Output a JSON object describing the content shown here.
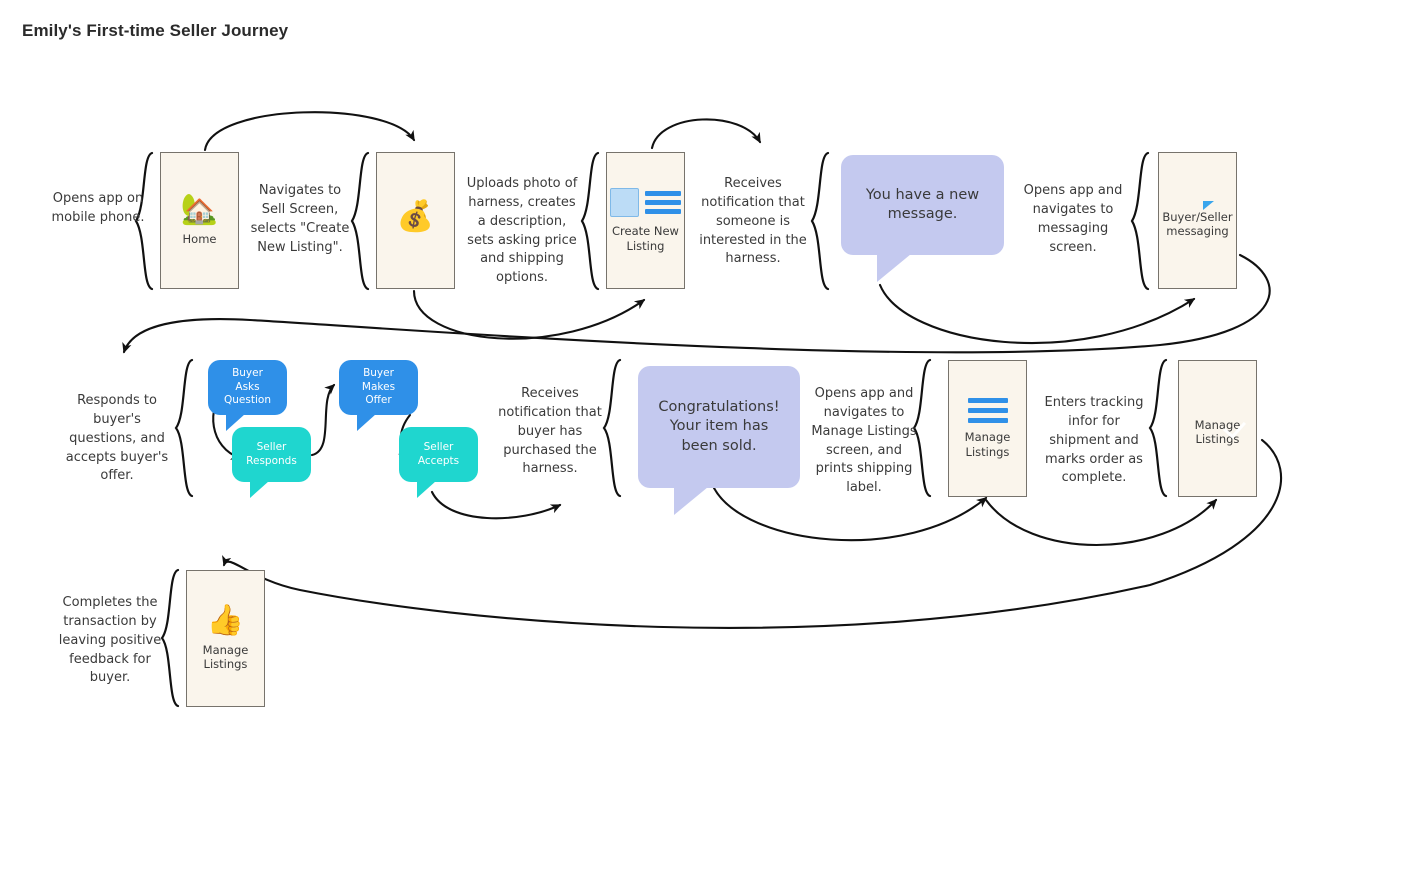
{
  "title": "Emily's First-time Seller Journey",
  "notes": [
    {
      "id": "n1",
      "text": "Opens app on mobile phone."
    },
    {
      "id": "n2",
      "text": "Navigates to Sell Screen, selects \"Create New Listing\"."
    },
    {
      "id": "n3",
      "text": "Uploads photo of harness, creates a description, sets asking price and shipping options."
    },
    {
      "id": "n4",
      "text": "Receives notification that someone is interested in the harness."
    },
    {
      "id": "n5",
      "text": "Opens app and navigates to messaging screen."
    },
    {
      "id": "n6",
      "text": "Responds to buyer's questions, and accepts buyer's offer."
    },
    {
      "id": "n7",
      "text": "Receives notification that buyer has purchased the harness."
    },
    {
      "id": "n8",
      "text": "Opens app and navigates to Manage Listings screen, and prints shipping label."
    },
    {
      "id": "n9",
      "text": "Enters tracking infor for shipment and marks order as complete."
    },
    {
      "id": "n10",
      "text": "Completes the transaction by leaving positive feedback for buyer."
    }
  ],
  "cards": [
    {
      "id": "c-home",
      "label": "Home",
      "icon": "house-emoji"
    },
    {
      "id": "c-money",
      "label": "",
      "icon": "money-bag-emoji"
    },
    {
      "id": "c-newlist",
      "label": "Create New Listing",
      "icon": "new-listing-icon"
    },
    {
      "id": "c-messaging",
      "label": "Buyer/Seller messaging",
      "icon": "chat-bubble-icon"
    },
    {
      "id": "c-manage1",
      "label": "Manage Listings",
      "icon": "list-lines-icon"
    },
    {
      "id": "c-manage2",
      "label": "Manage Listings",
      "icon": "green-check-icon"
    },
    {
      "id": "c-manage3",
      "label": "Manage Listings",
      "icon": "thumbs-up-emoji"
    }
  ],
  "bubbles": [
    {
      "id": "b-newmsg",
      "text": "You have a new message.",
      "kind": "lavender"
    },
    {
      "id": "b-ask",
      "text": "Buyer Asks Question",
      "kind": "blue"
    },
    {
      "id": "b-respond",
      "text": "Seller Responds",
      "kind": "teal"
    },
    {
      "id": "b-offer",
      "text": "Buyer Makes Offer",
      "kind": "blue"
    },
    {
      "id": "b-accept",
      "text": "Seller Accepts",
      "kind": "teal"
    },
    {
      "id": "b-congrats",
      "text": "Congratulations! Your item has been sold.",
      "kind": "lavender"
    }
  ],
  "emoji": {
    "house": "🏡",
    "money_bag": "💰",
    "thumbs_up": "👍"
  },
  "colors": {
    "card_fill": "#faf5ec",
    "card_border": "#77736c",
    "lavender": "#c4c9ef",
    "blue": "#2f90e8",
    "teal": "#1fd6cf",
    "green": "#22c55e",
    "stroke": "#111111"
  }
}
